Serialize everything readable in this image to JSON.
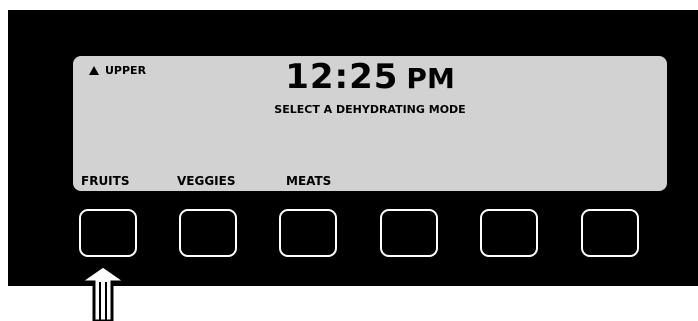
{
  "display": {
    "level_indicator": "UPPER",
    "level_icon": "triangle-up-icon",
    "time": "12:25",
    "ampm": "PM",
    "prompt": "SELECT A DEHYDRATING MODE",
    "mode_labels": [
      "FRUITS",
      "VEGGIES",
      "MEATS"
    ]
  },
  "softkeys": {
    "count": 6,
    "highlighted_index": 0
  },
  "pointer": {
    "icon": "up-arrow-icon",
    "target": "softkey-1"
  },
  "colors": {
    "panel": "#000000",
    "lcd": "#d2d2d2",
    "lcd_text": "#000000",
    "key_border": "#ffffff",
    "arrow": "#ffffff"
  }
}
